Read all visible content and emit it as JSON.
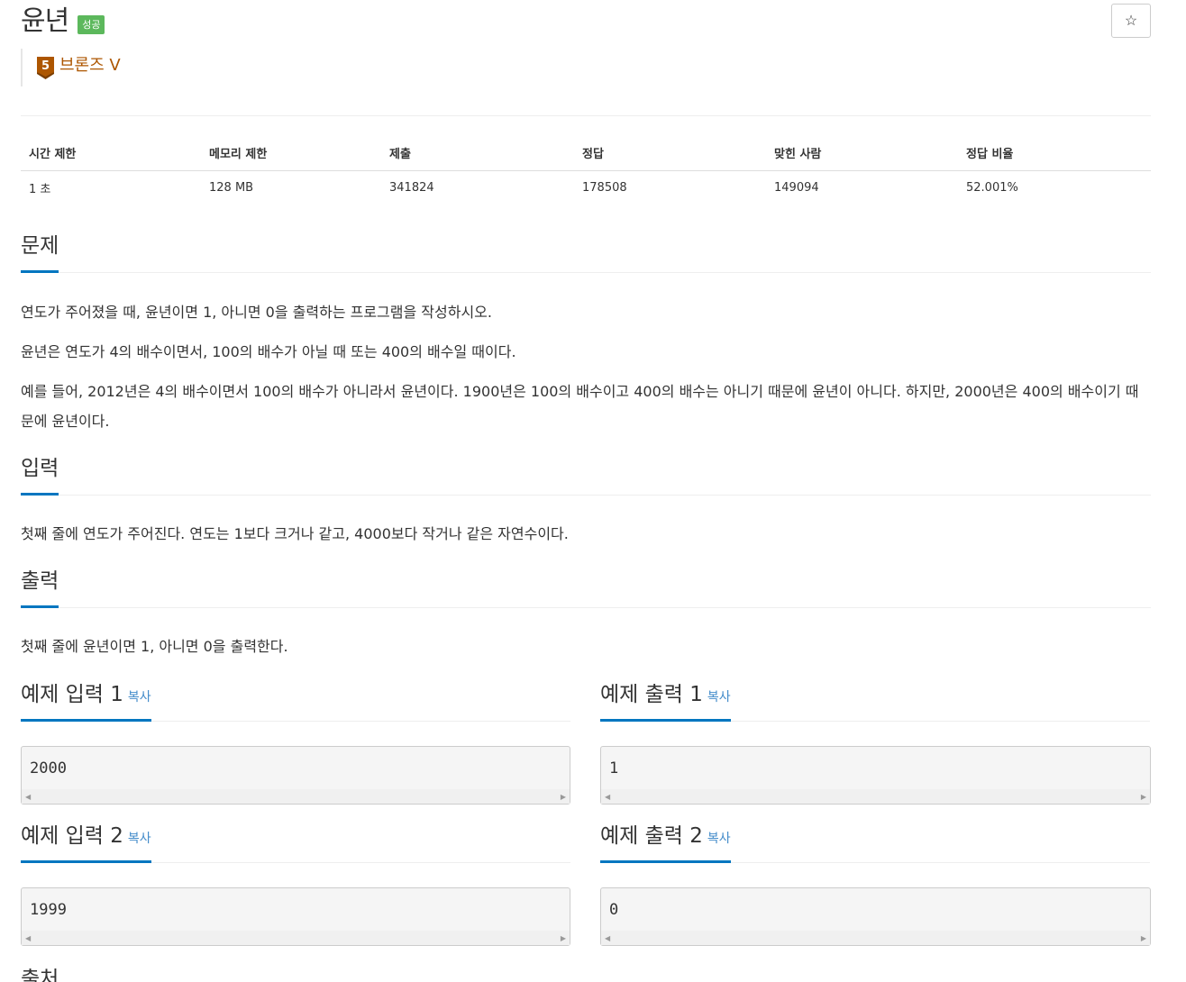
{
  "problem": {
    "title": "윤년",
    "status_badge": "성공",
    "star_label": "☆",
    "tier": {
      "label": "브론즈 V",
      "level": "5",
      "color": "#ad5600"
    }
  },
  "info_table": {
    "headers": [
      "시간 제한",
      "메모리 제한",
      "제출",
      "정답",
      "맞힌 사람",
      "정답 비율"
    ],
    "values": [
      "1 초",
      "128 MB",
      "341824",
      "178508",
      "149094",
      "52.001%"
    ]
  },
  "sections": {
    "description": {
      "heading": "문제",
      "paragraphs": [
        "연도가 주어졌을 때, 윤년이면 1, 아니면 0을 출력하는 프로그램을 작성하시오.",
        "윤년은 연도가 4의 배수이면서, 100의 배수가 아닐 때 또는 400의 배수일 때이다.",
        "예를 들어, 2012년은 4의 배수이면서 100의 배수가 아니라서 윤년이다. 1900년은 100의 배수이고 400의 배수는 아니기 때문에 윤년이 아니다. 하지만, 2000년은 400의 배수이기 때문에 윤년이다."
      ]
    },
    "input": {
      "heading": "입력",
      "text": "첫째 줄에 연도가 주어진다. 연도는 1보다 크거나 같고, 4000보다 작거나 같은 자연수이다."
    },
    "output": {
      "heading": "출력",
      "text": "첫째 줄에 윤년이면 1, 아니면 0을 출력한다."
    }
  },
  "samples": [
    {
      "input_heading": "예제 입력 1",
      "output_heading": "예제 출력 1",
      "copy_label": "복사",
      "input": "2000",
      "output": "1"
    },
    {
      "input_heading": "예제 입력 2",
      "output_heading": "예제 출력 2",
      "copy_label": "복사",
      "input": "1999",
      "output": "0"
    }
  ],
  "footer": {
    "heading": "출처"
  },
  "colors": {
    "accent": "#0076c0",
    "success": "#5cb85c",
    "link": "#428bca"
  }
}
